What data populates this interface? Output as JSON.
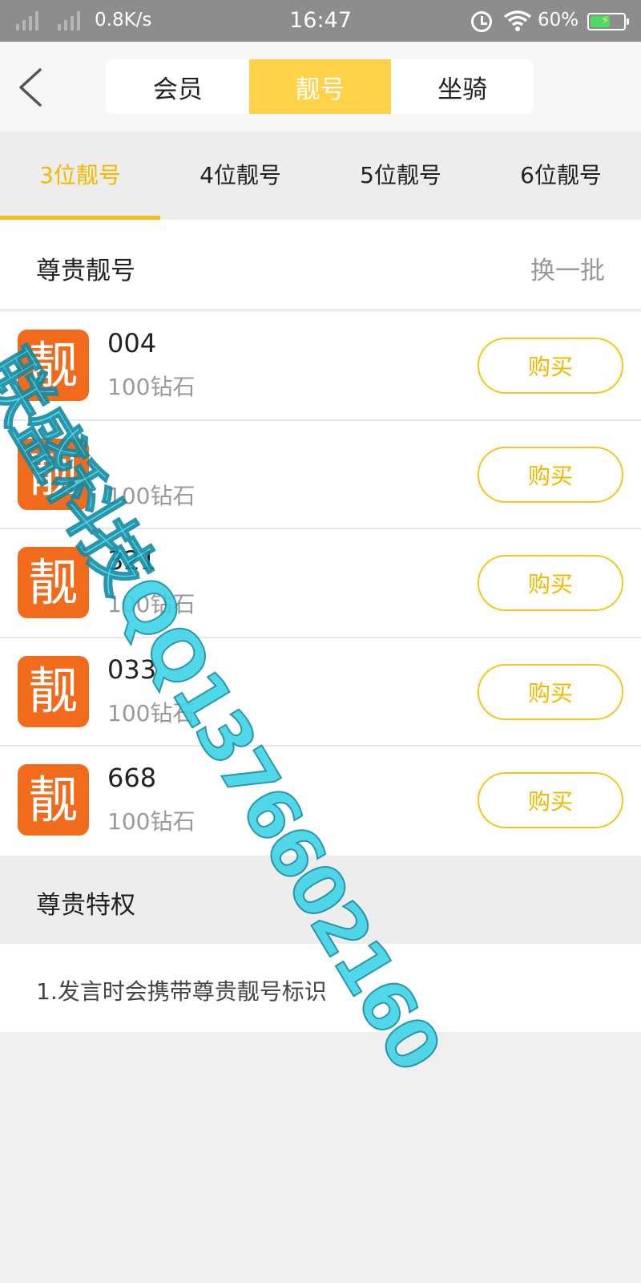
{
  "status_bar": {
    "speed": "0.8K/s",
    "time": "16:47",
    "battery": "60%",
    "battery_level": 0.6
  },
  "header": {
    "tabs": [
      {
        "label": "会员",
        "active": false
      },
      {
        "label": "靓号",
        "active": true
      },
      {
        "label": "坐骑",
        "active": false
      }
    ]
  },
  "categories": [
    {
      "label": "3位靓号",
      "active": true
    },
    {
      "label": "4位靓号",
      "active": false
    },
    {
      "label": "5位靓号",
      "active": false
    },
    {
      "label": "6位靓号",
      "active": false
    }
  ],
  "section": {
    "title": "尊贵靓号",
    "refresh": "换一批"
  },
  "numbers": [
    {
      "badge": "靓",
      "number": "004",
      "price": "100钻石",
      "buy": "购买"
    },
    {
      "badge": "靓",
      "number": "",
      "price": "100钻石",
      "buy": "购买"
    },
    {
      "badge": "靓",
      "number": "321",
      "price": "100钻石",
      "buy": "购买"
    },
    {
      "badge": "靓",
      "number": "033",
      "price": "100钻石",
      "buy": "购买"
    },
    {
      "badge": "靓",
      "number": "668",
      "price": "100钻石",
      "buy": "购买"
    }
  ],
  "privileges": {
    "title": "尊贵特权",
    "item": "1.发言时会携带尊贵靓号标识"
  },
  "watermark": "联盛科技QQ1376602160",
  "colors": {
    "accent": "#ffd24a",
    "accent_text": "#f5b800",
    "badge": "#f26a1b",
    "watermark": "#3fd4e6"
  }
}
